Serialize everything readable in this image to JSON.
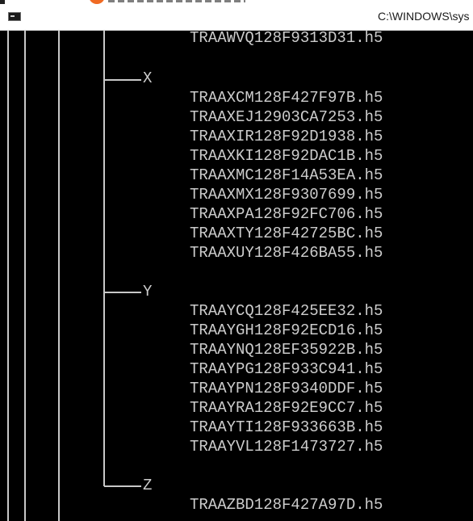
{
  "window": {
    "title": "C:\\WINDOWS\\sys",
    "icon": "console-icon"
  },
  "tree": {
    "top_file": "TRAAWVQ128F9313D31.h5",
    "groups": [
      {
        "label": "X",
        "files": [
          "TRAAXCM128F427F97B.h5",
          "TRAAXEJ12903CA7253.h5",
          "TRAAXIR128F92D1938.h5",
          "TRAAXKI128F92DAC1B.h5",
          "TRAAXMC128F14A53EA.h5",
          "TRAAXMX128F9307699.h5",
          "TRAAXPA128F92FC706.h5",
          "TRAAXTY128F42725BC.h5",
          "TRAAXUY128F426BA55.h5"
        ]
      },
      {
        "label": "Y",
        "files": [
          "TRAAYCQ128F425EE32.h5",
          "TRAAYGH128F92ECD16.h5",
          "TRAAYNQ128EF35922B.h5",
          "TRAAYPG128F933C941.h5",
          "TRAAYPN128F9340DDF.h5",
          "TRAAYRA128F92E9CC7.h5",
          "TRAAYTI128F933663B.h5",
          "TRAAYVL128F1473727.h5"
        ]
      },
      {
        "label": "Z",
        "files": [
          "TRAAZBD128F427A97D.h5"
        ]
      }
    ]
  }
}
